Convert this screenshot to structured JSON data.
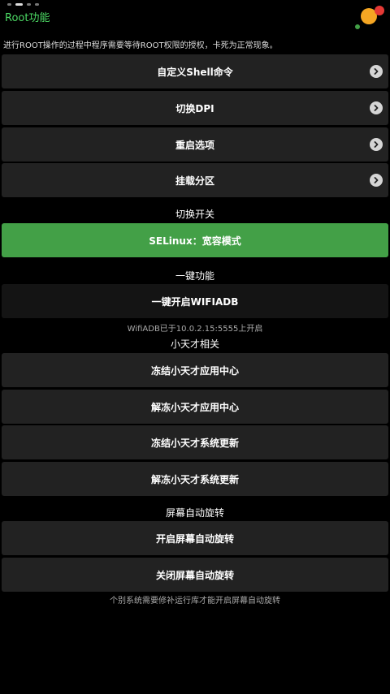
{
  "header": {
    "title": "Root功能",
    "notice": "进行ROOT操作的过程中程序需要等待ROOT权限的授权，卡死为正常现象。"
  },
  "menu": {
    "custom_shell": "自定义Shell命令",
    "switch_dpi": "切换DPI",
    "reboot_options": "重启选项",
    "mount_partition": "挂载分区"
  },
  "switch_section": {
    "title": "切换开关",
    "selinux": "SELinux：宽容模式"
  },
  "one_key_section": {
    "title": "一键功能",
    "wifi_adb": "一键开启WIFIADB",
    "wifi_adb_status": "WifiADB已于10.0.2.15:5555上开启"
  },
  "xtc_section": {
    "title": "小天才相关",
    "freeze_app_center": "冻结小天才应用中心",
    "unfreeze_app_center": "解冻小天才应用中心",
    "freeze_system_update": "冻结小天才系统更新",
    "unfreeze_system_update": "解冻小天才系统更新"
  },
  "rotation_section": {
    "title": "屏幕自动旋转",
    "enable": "开启屏幕自动旋转",
    "disable": "关闭屏幕自动旋转",
    "note": "个别系统需要修补运行库才能开启屏幕自动旋转"
  },
  "colors": {
    "accent_green": "#4cd964",
    "selinux_button": "#43a047",
    "button_bg": "#222222"
  }
}
